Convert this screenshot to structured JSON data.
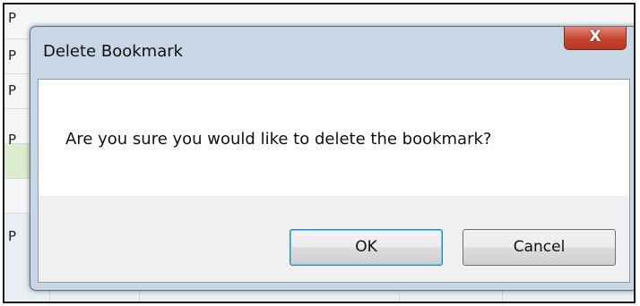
{
  "background": {
    "rows": [
      {
        "cell": "P"
      },
      {
        "cell": "P"
      },
      {
        "cell": "P"
      },
      {
        "cell": "P"
      },
      {
        "cell": "P"
      },
      {
        "cell": "P"
      }
    ]
  },
  "dialog": {
    "title": "Delete Bookmark",
    "close_label": "X",
    "message": "Are you sure you would like to delete the bookmark?",
    "ok_label": "OK",
    "cancel_label": "Cancel"
  },
  "colors": {
    "close_button": "#c5452f",
    "ok_focus_border": "#3c7fb1",
    "highlighted_row": "#dceccf"
  }
}
